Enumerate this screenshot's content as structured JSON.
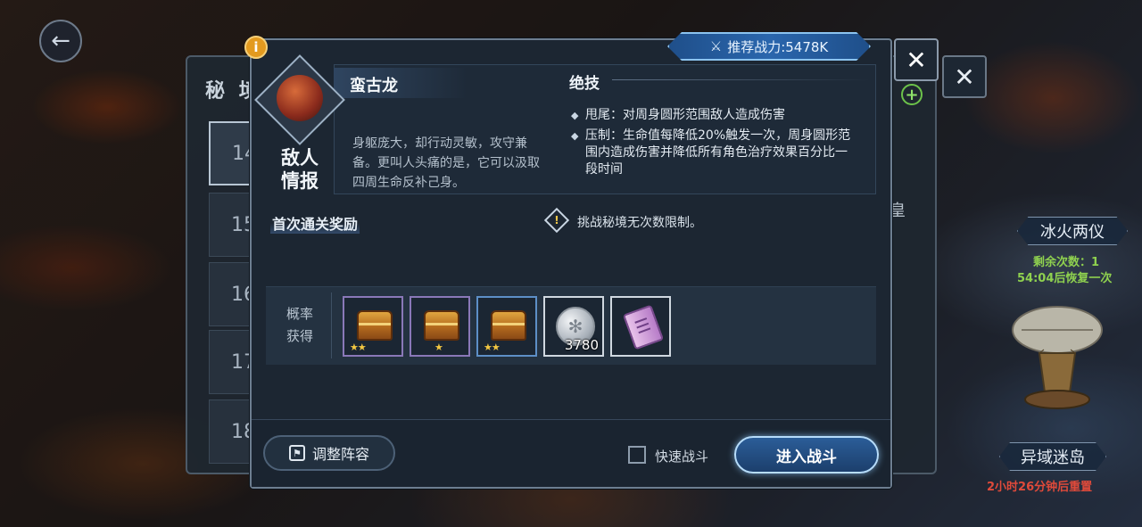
{
  "nav": {
    "back_icon": "arrow-left-icon",
    "back_glyph": "←"
  },
  "background_dialog": {
    "title": "秘 境",
    "levels": [
      "14",
      "15",
      "16",
      "17",
      "18"
    ],
    "side_char": "皇",
    "close_glyph": "✕",
    "plus_glyph": "+"
  },
  "map": {
    "locations": [
      {
        "name": "冰火两仪",
        "sub1": "剩余次数：1",
        "sub2": "54:04后恢复一次"
      },
      {
        "name": "异域迷岛",
        "sub1": "2小时26分钟后重置"
      }
    ],
    "colors": {
      "green_text": "#8fd14f",
      "red_text": "#e04a3a",
      "white_text": "#e6e6e6"
    }
  },
  "modal": {
    "info_glyph": "i",
    "power_label": "推荐战力:5478K",
    "close_glyph": "✕",
    "enemy": {
      "label": "敌人\n情报",
      "name": "蛮古龙",
      "description": "身躯庞大，却行动灵敏，攻守兼备。更叫人头痛的是，它可以汲取四周生命反补己身。"
    },
    "skills": {
      "title": "绝技",
      "items": [
        "甩尾：对周身圆形范围敌人造成伤害",
        "压制：生命值每降低20%触发一次，周身圆形范围内造成伤害并降低所有角色治疗效果百分比一段时间"
      ]
    },
    "reward_title": "首次通关奖励",
    "notice": "挑战秘境无次数限制。",
    "drop": {
      "label": "概率\n获得",
      "items": [
        {
          "icon": "treasure-chest-icon",
          "stars": "★★",
          "rarity": "purple"
        },
        {
          "icon": "treasure-chest-icon",
          "stars": "★",
          "rarity": "purple"
        },
        {
          "icon": "treasure-chest-icon",
          "stars": "★★",
          "rarity": "blue"
        },
        {
          "icon": "silver-coin-icon",
          "count": "3780",
          "rarity": "white"
        },
        {
          "icon": "scroll-icon",
          "rarity": "white"
        }
      ]
    },
    "buttons": {
      "adjust": "调整阵容",
      "quick_battle": "快速战斗",
      "enter": "进入战斗"
    },
    "colors": {
      "accent_blue": "#2b66ad",
      "border": "#6d7e90",
      "gold": "#f4c842"
    }
  }
}
